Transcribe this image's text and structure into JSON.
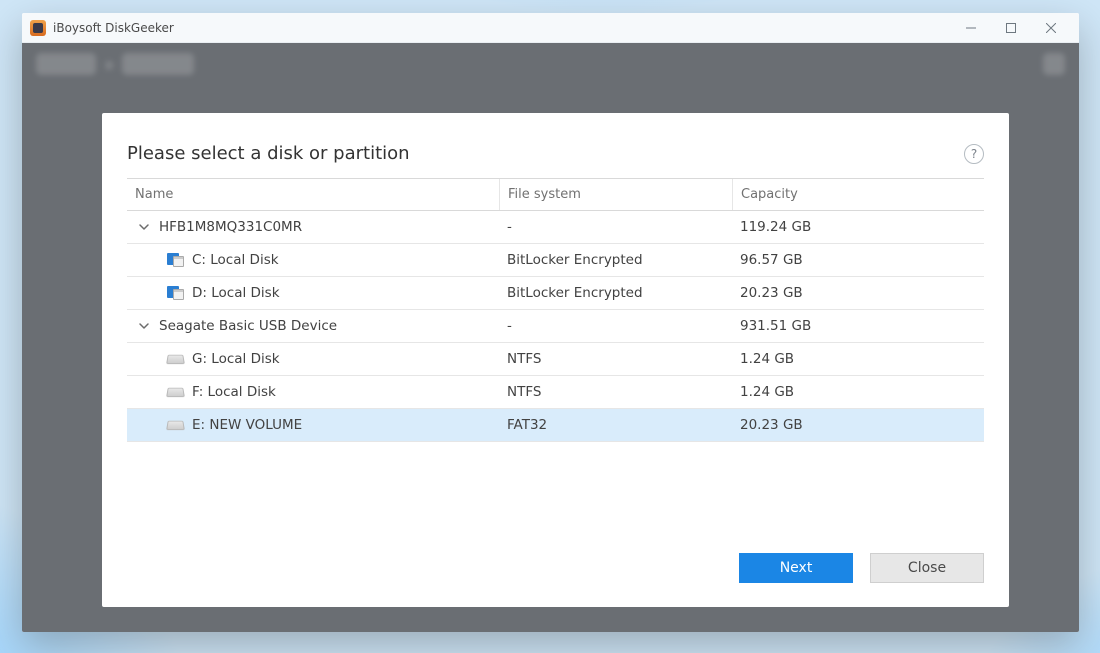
{
  "window": {
    "title": "iBoysoft DiskGeeker"
  },
  "dialog": {
    "title": "Please select a disk or partition",
    "columns": {
      "name": "Name",
      "fs": "File system",
      "capacity": "Capacity"
    },
    "buttons": {
      "next": "Next",
      "close": "Close"
    }
  },
  "rows": [
    {
      "kind": "disk",
      "name": "HFB1M8MQ331C0MR",
      "fs": "-",
      "capacity": "119.24 GB"
    },
    {
      "kind": "part",
      "icon": "win-lock",
      "name": "C: Local Disk",
      "fs": "BitLocker Encrypted",
      "capacity": "96.57 GB"
    },
    {
      "kind": "part",
      "icon": "lock",
      "name": "D: Local Disk",
      "fs": "BitLocker Encrypted",
      "capacity": "20.23 GB"
    },
    {
      "kind": "disk",
      "name": "Seagate Basic USB Device",
      "fs": "-",
      "capacity": "931.51 GB"
    },
    {
      "kind": "part",
      "icon": "disk",
      "name": "G: Local Disk",
      "fs": "NTFS",
      "capacity": "1.24 GB"
    },
    {
      "kind": "part",
      "icon": "disk",
      "name": "F: Local Disk",
      "fs": "NTFS",
      "capacity": "1.24 GB"
    },
    {
      "kind": "part",
      "icon": "disk",
      "name": "E: NEW VOLUME",
      "fs": "FAT32",
      "capacity": "20.23 GB",
      "selected": true
    }
  ]
}
